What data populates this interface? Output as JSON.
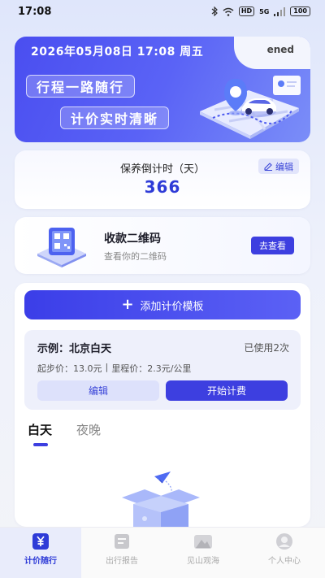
{
  "status_bar": {
    "time": "17:08",
    "hd_label": "HD",
    "network": "5G",
    "battery": "100"
  },
  "banner": {
    "datetime": "2026年05月08日 17:08 周五",
    "user": "ened",
    "slogan_1": "行程一路随行",
    "slogan_2": "计价实时清晰"
  },
  "countdown": {
    "title": "保养倒计时（天）",
    "value": "366",
    "edit_label": "编辑"
  },
  "qr": {
    "title": "收款二维码",
    "subtitle": "查看你的二维码",
    "button": "去查看"
  },
  "main": {
    "add_label": "添加计价模板",
    "template": {
      "name": "示例：北京白天",
      "used": "已使用2次",
      "base_price": "起步价：13.0元",
      "separator": "|",
      "mileage_price": "里程价：2.3元/公里",
      "edit_label": "编辑",
      "start_label": "开始计费"
    },
    "tabs": [
      {
        "label": "白天",
        "active": true
      },
      {
        "label": "夜晚",
        "active": false
      }
    ]
  },
  "nav": [
    {
      "label": "计价随行",
      "icon": "yen-icon",
      "active": true
    },
    {
      "label": "出行报告",
      "icon": "report-icon",
      "active": false
    },
    {
      "label": "见山观海",
      "icon": "mountain-icon",
      "active": false
    },
    {
      "label": "个人中心",
      "icon": "user-icon",
      "active": false
    }
  ],
  "colors": {
    "accent": "#3d3fe0",
    "accent_text": "#2e3bd7",
    "banner_start": "#4a4ef0",
    "banner_end": "#7b8ef8"
  }
}
